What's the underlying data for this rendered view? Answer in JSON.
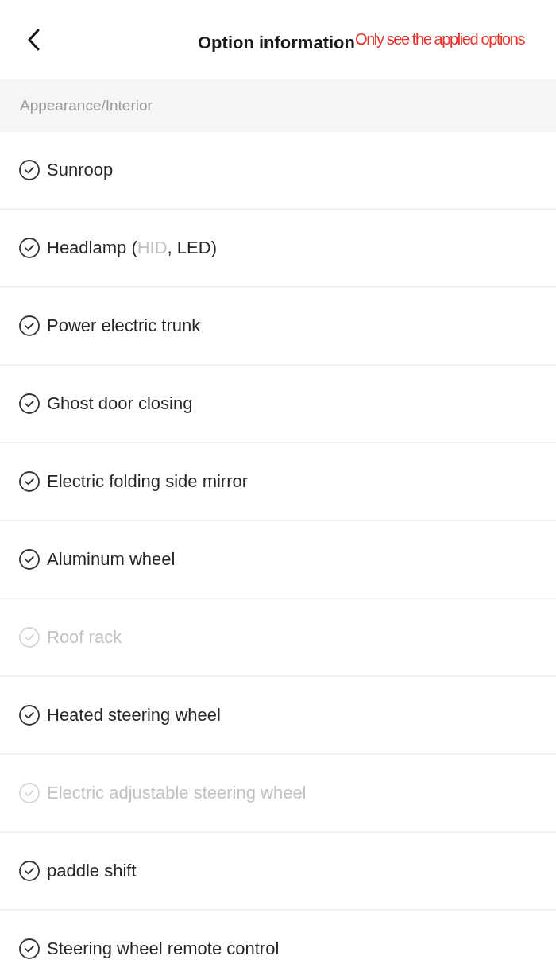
{
  "header": {
    "title": "Option information",
    "note": "Only see the applied options"
  },
  "section": {
    "title": "Appearance/Interior"
  },
  "options": [
    {
      "label": "Sunroop",
      "applied": true
    },
    {
      "applied": true,
      "parts": [
        {
          "text": "Headlamp (",
          "applied": true
        },
        {
          "text": "HID",
          "applied": false
        },
        {
          "text": ", LED)",
          "applied": true
        }
      ]
    },
    {
      "label": "Power electric trunk",
      "applied": true
    },
    {
      "label": "Ghost door closing",
      "applied": true
    },
    {
      "label": "Electric folding side mirror",
      "applied": true
    },
    {
      "label": "Aluminum wheel",
      "applied": true
    },
    {
      "label": "Roof rack",
      "applied": false
    },
    {
      "label": "Heated steering wheel",
      "applied": true
    },
    {
      "label": "Electric adjustable steering wheel",
      "applied": false
    },
    {
      "label": "paddle shift",
      "applied": true
    },
    {
      "label": "Steering wheel remote control",
      "applied": true
    }
  ]
}
